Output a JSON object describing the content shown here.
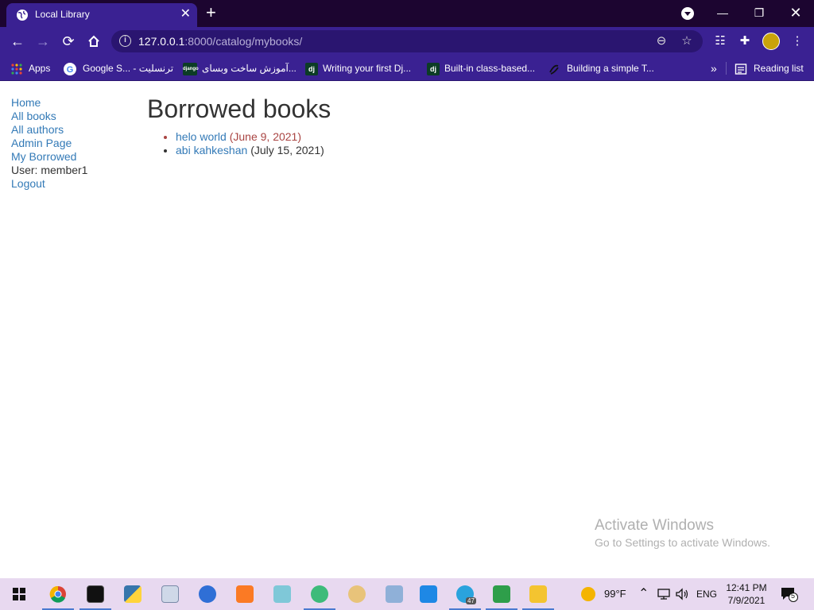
{
  "browser": {
    "tab_title": "Local Library",
    "url_host": "127.0.0.1",
    "url_rest": ":8000/catalog/mybooks/"
  },
  "bookmarks": {
    "apps": "Apps",
    "items": [
      {
        "label": "Google S... - ترنسلیت"
      },
      {
        "label": "آموزش ساخت وبسای...",
        "icon_text": "django"
      },
      {
        "label": "Writing your first Dj...",
        "icon_text": "dj"
      },
      {
        "label": "Built-in class-based...",
        "icon_text": "dj"
      },
      {
        "label": "Building a simple T..."
      }
    ],
    "more": "»",
    "reading_list": "Reading list"
  },
  "sidebar": {
    "home": "Home",
    "all_books": "All books",
    "all_authors": "All authors",
    "admin_page": "Admin Page",
    "my_borrowed": "My Borrowed",
    "user": "User: member1",
    "logout": "Logout"
  },
  "main": {
    "title": "Borrowed books",
    "books": [
      {
        "title": "helo world",
        "due": "(June 9, 2021)",
        "overdue": true
      },
      {
        "title": "abi kahkeshan",
        "due": "(July 15, 2021)",
        "overdue": false
      }
    ]
  },
  "watermark": {
    "line1": "Activate Windows",
    "line2": "Go to Settings to activate Windows."
  },
  "taskbar": {
    "weather": "99°F",
    "lang": "ENG",
    "time": "12:41 PM",
    "date": "7/9/2021",
    "notifications": "5",
    "telegram_badge": "47"
  },
  "colors": {
    "titlebar": "#1c0530",
    "toolbar": "#3a2192",
    "link": "#337ab7",
    "overdue": "#a94442",
    "taskbar": "#e8d9f0"
  }
}
